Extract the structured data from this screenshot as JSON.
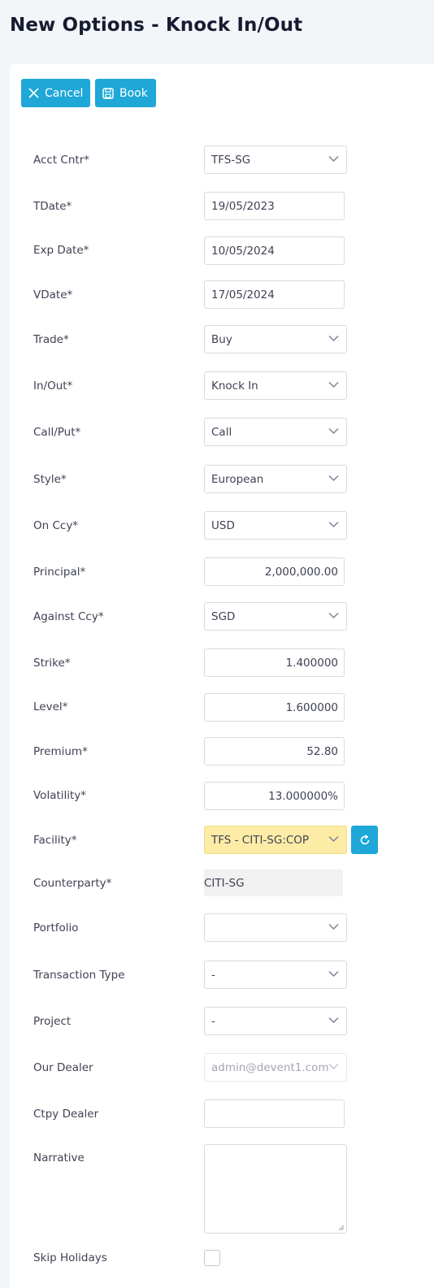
{
  "page": {
    "title": "New Options - Knock In/Out"
  },
  "toolbar": {
    "cancel_label": "Cancel",
    "book_label": "Book"
  },
  "fields": {
    "acct_cntr": {
      "label": "Acct Cntr*",
      "value": "TFS-SG"
    },
    "tdate": {
      "label": "TDate*",
      "value": "19/05/2023"
    },
    "exp_date": {
      "label": "Exp Date*",
      "value": "10/05/2024"
    },
    "vdate": {
      "label": "VDate*",
      "value": "17/05/2024"
    },
    "trade": {
      "label": "Trade*",
      "value": "Buy"
    },
    "in_out": {
      "label": "In/Out*",
      "value": "Knock In"
    },
    "call_put": {
      "label": "Call/Put*",
      "value": "Call"
    },
    "style": {
      "label": "Style*",
      "value": "European"
    },
    "on_ccy": {
      "label": "On Ccy*",
      "value": "USD"
    },
    "principal": {
      "label": "Principal*",
      "value": "2,000,000.00"
    },
    "against_ccy": {
      "label": "Against Ccy*",
      "value": "SGD"
    },
    "strike": {
      "label": "Strike*",
      "value": "1.400000"
    },
    "level": {
      "label": "Level*",
      "value": "1.600000"
    },
    "premium": {
      "label": "Premium*",
      "value": "52.80"
    },
    "volatility": {
      "label": "Volatility*",
      "value": "13.000000%"
    },
    "facility": {
      "label": "Facility*",
      "value": "TFS - CITI-SG:COP"
    },
    "counterparty": {
      "label": "Counterparty*",
      "value": "CITI-SG"
    },
    "portfolio": {
      "label": "Portfolio",
      "value": ""
    },
    "transaction_type": {
      "label": "Transaction Type",
      "value": "-"
    },
    "project": {
      "label": "Project",
      "value": "-"
    },
    "our_dealer": {
      "label": "Our Dealer",
      "value": "admin@devent1.com"
    },
    "ctpy_dealer": {
      "label": "Ctpy Dealer",
      "value": ""
    },
    "narrative": {
      "label": "Narrative",
      "value": ""
    },
    "skip_holidays": {
      "label": "Skip Holidays",
      "checked": false
    }
  },
  "colors": {
    "accent": "#1ea7d7",
    "facility_highlight": "#fdeca6",
    "readonly_bg": "#f1f1f2"
  },
  "icons": {
    "cancel": "close-icon",
    "book": "save-icon",
    "select": "chevron-down-icon",
    "refresh": "refresh-icon"
  }
}
